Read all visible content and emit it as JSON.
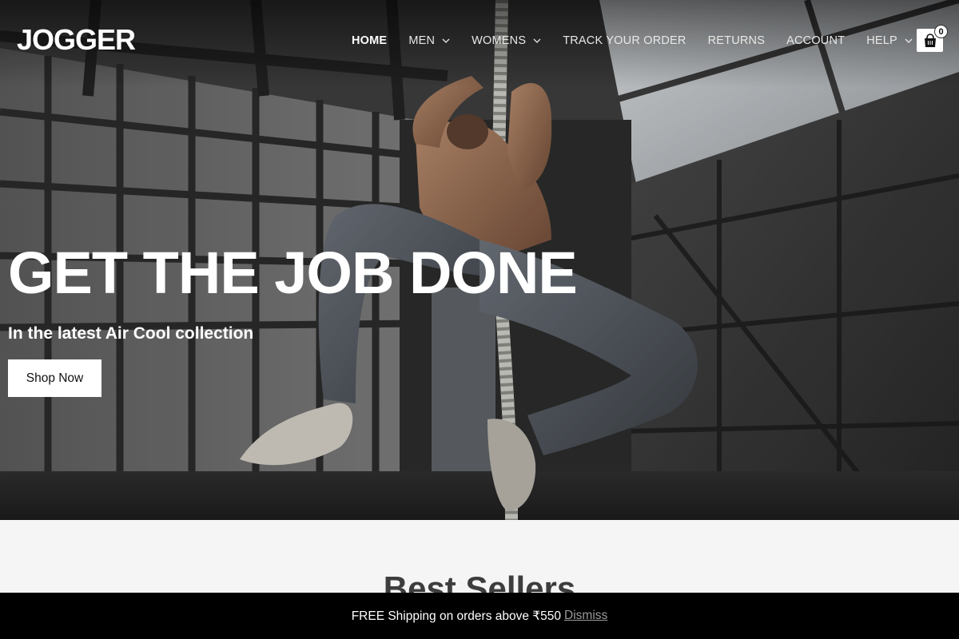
{
  "brand": {
    "logo_text": "JOGGER"
  },
  "nav": {
    "items": [
      {
        "label": "HOME",
        "active": true,
        "has_dropdown": false
      },
      {
        "label": "MEN",
        "active": false,
        "has_dropdown": true
      },
      {
        "label": "WOMENS",
        "active": false,
        "has_dropdown": true
      },
      {
        "label": "TRACK YOUR ORDER",
        "active": false,
        "has_dropdown": false
      },
      {
        "label": "RETURNS",
        "active": false,
        "has_dropdown": false
      },
      {
        "label": "ACCOUNT",
        "active": false,
        "has_dropdown": false
      },
      {
        "label": "HELP",
        "active": false,
        "has_dropdown": true
      }
    ],
    "cart": {
      "icon": "shopping-bag-icon",
      "count": "0"
    }
  },
  "hero": {
    "title": "GET THE JOB DONE",
    "subtitle": "In the latest Air Cool collection",
    "cta_label": "Shop Now",
    "image": "man-climbing-rope-gym-photo"
  },
  "best_sellers": {
    "title": "Best Sellers"
  },
  "notice_bar": {
    "text": "FREE Shipping on orders above ₹550",
    "dismiss_label": "Dismiss"
  },
  "colors": {
    "notice_bg": "#000000",
    "page_bg": "#f5f5f5",
    "text_light": "#ffffff",
    "title_dark": "#3d3d3d",
    "dismiss_link": "#9a9a9a"
  }
}
